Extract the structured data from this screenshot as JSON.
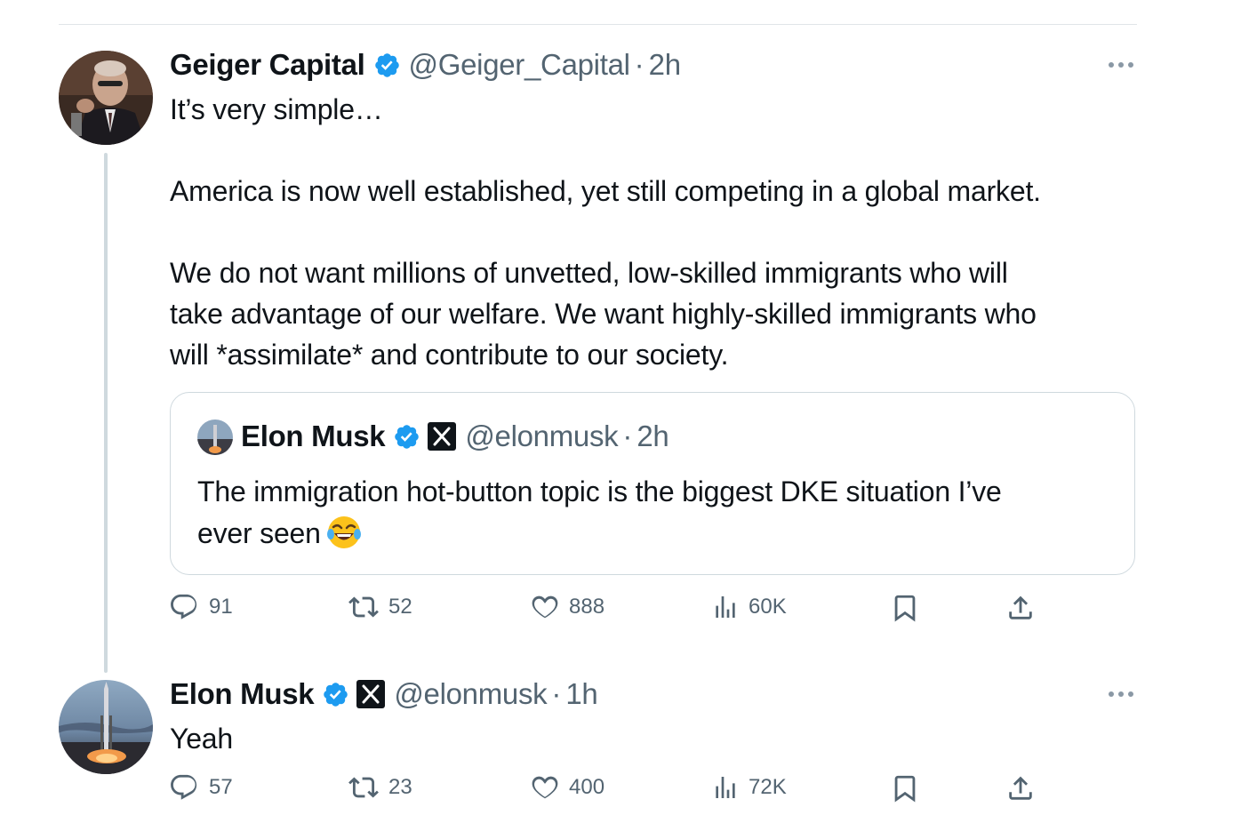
{
  "thread": [
    {
      "author": {
        "name": "Geiger Capital",
        "handle": "@Geiger_Capital",
        "time": "2h",
        "verified": true
      },
      "text": "It’s very simple…\n\nAmerica is now well established, yet still competing in a global market.\n\nWe do not want millions of unvetted, low-skilled immigrants who will\ntake advantage of our welfare. We want highly-skilled immigrants who\nwill *assimilate* and contribute to our society.",
      "quote": {
        "author": {
          "name": "Elon Musk",
          "handle": "@elonmusk",
          "time": "2h",
          "verified": true,
          "affiliate_badge": "X"
        },
        "text": "The immigration hot-button topic is the biggest DKE situation I’ve\never seen",
        "emoji": "face-with-tears-of-joy"
      },
      "actions": {
        "replies": "91",
        "reposts": "52",
        "likes": "888",
        "views": "60K"
      }
    },
    {
      "author": {
        "name": "Elon Musk",
        "handle": "@elonmusk",
        "time": "1h",
        "verified": true,
        "affiliate_badge": "X"
      },
      "text": "Yeah",
      "actions": {
        "replies": "57",
        "reposts": "23",
        "likes": "400",
        "views": "72K"
      }
    }
  ],
  "dot_separator": "·",
  "colors": {
    "text": "#0f1419",
    "muted": "#536471",
    "verified": "#1d9bf0",
    "border": "#cfd9de"
  },
  "icons": [
    "verified-icon",
    "x-badge-icon",
    "more-icon",
    "reply-icon",
    "repost-icon",
    "like-icon",
    "views-icon",
    "bookmark-icon",
    "share-icon"
  ]
}
